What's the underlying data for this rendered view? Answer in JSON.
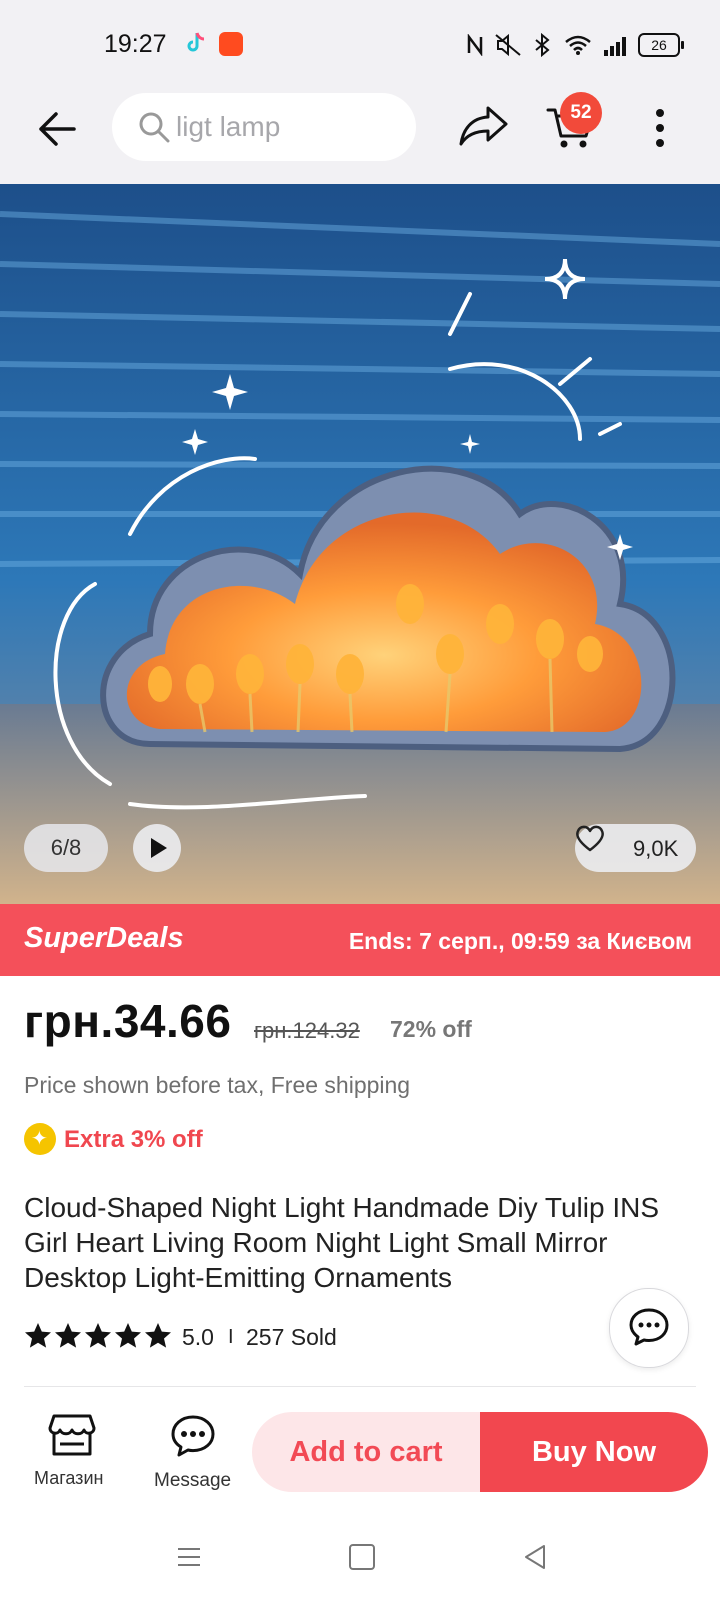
{
  "status_bar": {
    "time": "19:27",
    "battery": "26"
  },
  "header": {
    "search_placeholder": "ligt lamp",
    "cart_count": "52"
  },
  "gallery": {
    "counter": "6/8",
    "likes": "9,0K"
  },
  "deals": {
    "title": "SuperDeals",
    "ends": "Ends: 7 серп., 09:59 за Києвом"
  },
  "pricing": {
    "price": "грн.34.66",
    "original_price": "грн.124.32",
    "discount": "72% off",
    "tax_note": "Price shown before tax, Free shipping",
    "extra": "Extra 3% off"
  },
  "product": {
    "title": "Cloud-Shaped Night Light Handmade Diy Tulip INS Girl Heart Living Room Night Light Small Mirror Desktop Light-Emitting Ornaments",
    "rating": "5.0",
    "separator": "I",
    "sold": "257 Sold",
    "stars": 5
  },
  "actions": {
    "store_label": "Магазин",
    "message_label": "Message",
    "add_to_cart": "Add to cart",
    "buy_now": "Buy Now"
  },
  "colors": {
    "accent": "#f2474f",
    "star": "#111111",
    "deals_bg": "#f4505a"
  },
  "icons": [
    "back-arrow-icon",
    "search-icon",
    "share-icon",
    "cart-icon",
    "more-icon",
    "play-icon",
    "heart-icon",
    "star-icon",
    "chat-icon",
    "store-icon",
    "message-icon"
  ]
}
